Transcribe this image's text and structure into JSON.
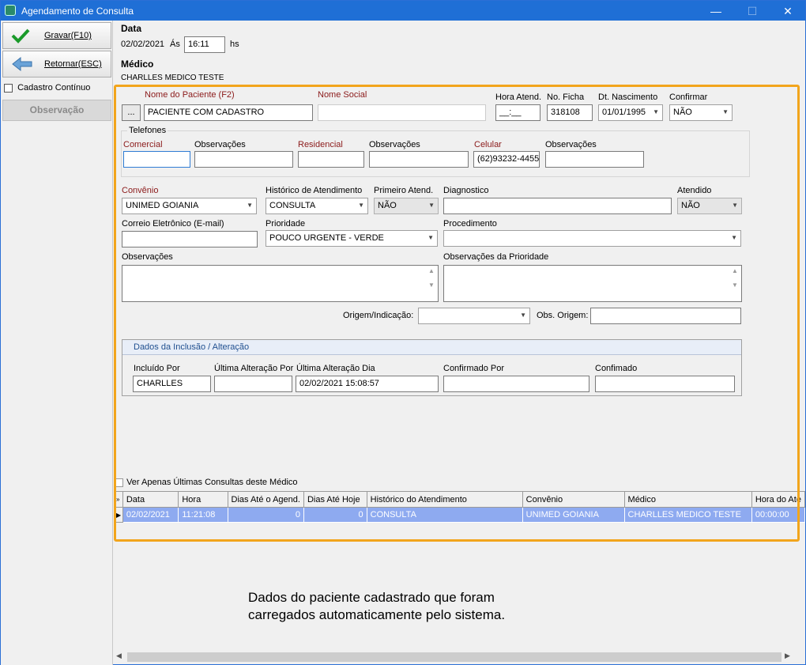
{
  "window": {
    "title": "Agendamento de Consulta",
    "minimize": "—",
    "maximize": "☐",
    "close": "✕"
  },
  "sidebar": {
    "save_label": "Gravar(F10)",
    "back_label": "Retornar(ESC)",
    "continuous_label": "Cadastro Contínuo",
    "obs_label": "Observação"
  },
  "header": {
    "data_title": "Data",
    "date": "02/02/2021",
    "as_label": "Ás",
    "time": "16:11",
    "hs_label": "hs",
    "medico_title": "Médico",
    "medico_name": "CHARLLES MEDICO TESTE"
  },
  "patient": {
    "name_label": "Nome do Paciente (F2)",
    "lookup_btn": "...",
    "name_value": "PACIENTE COM CADASTRO",
    "social_label": "Nome Social",
    "social_value": "",
    "hora_label": "Hora Atend.",
    "hora_value": "__:__",
    "ficha_label": "No. Ficha",
    "ficha_value": "318108",
    "nasc_label": "Dt. Nascimento",
    "nasc_value": "01/01/1995",
    "confirmar_label": "Confirmar",
    "confirmar_value": "NÃO"
  },
  "phones": {
    "group_label": "Telefones",
    "comercial_label": "Comercial",
    "comercial_value": "",
    "obs1_label": "Observações",
    "residencial_label": "Residencial",
    "residencial_value": "",
    "obs2_label": "Observações",
    "celular_label": "Celular",
    "celular_value": "(62)93232-4455",
    "obs3_label": "Observações"
  },
  "form": {
    "convenio_label": "Convênio",
    "convenio_value": "UNIMED GOIANIA",
    "historico_label": "Histórico de Atendimento",
    "historico_value": "CONSULTA",
    "primeiro_label": "Primeiro Atend.",
    "primeiro_value": "NÃO",
    "diagnostico_label": "Diagnostico",
    "atendido_label": "Atendido",
    "atendido_value": "NÃO",
    "email_label": "Correio Eletrônico (E-mail)",
    "prioridade_label": "Prioridade",
    "prioridade_value": "POUCO URGENTE - VERDE",
    "procedimento_label": "Procedimento",
    "obs_label": "Observações",
    "obs_prioridade_label": "Observações da Prioridade",
    "origem_label": "Origem/Indicação:",
    "obs_origem_label": "Obs. Origem:"
  },
  "inclusao": {
    "title": "Dados da Inclusão / Alteração",
    "incluido_label": "Incluído Por",
    "incluido_value": "CHARLLES",
    "ult_alt_por_label": "Última Alteração Por",
    "ult_alt_dia_label": "Última Alteração Dia",
    "ult_alt_dia_value": "02/02/2021 15:08:57",
    "confirmado_label": "Confirmado Por",
    "confimado_label": "Confimado"
  },
  "history": {
    "filter_label": "Ver Apenas Últimas Consultas deste Médico",
    "columns": [
      "Data",
      "Hora",
      "Dias Até o Agend.",
      "Dias Até Hoje",
      "Histórico do Atendimento",
      "Convênio",
      "Médico",
      "Hora do Ate"
    ],
    "rows": [
      [
        "02/02/2021",
        "11:21:08",
        "0",
        "0",
        "CONSULTA",
        "UNIMED GOIANIA",
        "CHARLLES MEDICO TESTE",
        "00:00:00"
      ]
    ]
  },
  "annotation": {
    "line1": "Dados do paciente cadastrado que foram",
    "line2": "carregados automaticamente pelo sistema."
  },
  "colors": {
    "titlebar": "#1f6fd6",
    "highlight": "#f2a51c",
    "row_selected": "#8eaaf0"
  }
}
